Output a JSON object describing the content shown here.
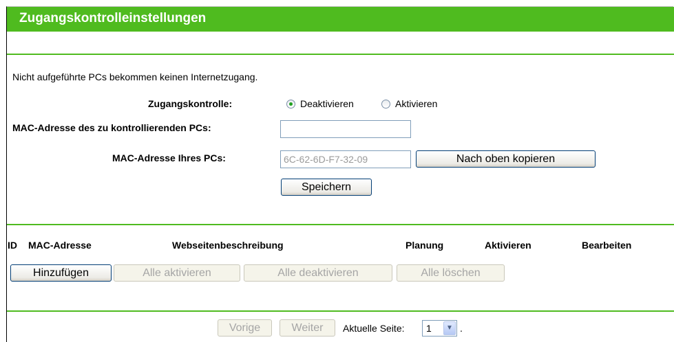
{
  "header": {
    "title": "Zugangskontrolleinstellungen"
  },
  "notice": "Nicht aufgeführte PCs bekommen keinen Internetzugang.",
  "access_control": {
    "label": "Zugangskontrolle:",
    "options": [
      {
        "label": "Deaktivieren",
        "selected": true
      },
      {
        "label": "Aktivieren",
        "selected": false
      }
    ]
  },
  "mac_control": {
    "label": "MAC-Adresse des zu kontrollierenden PCs:",
    "value": ""
  },
  "mac_own": {
    "label": "MAC-Adresse Ihres PCs:",
    "value": "6C-62-6D-F7-32-09",
    "copy_button": "Nach oben kopieren"
  },
  "save_button": "Speichern",
  "table": {
    "columns": [
      "ID",
      "MAC-Adresse",
      "Webseitenbeschreibung",
      "Planung",
      "Aktivieren",
      "Bearbeiten"
    ],
    "rows": []
  },
  "actions": {
    "add": "Hinzufügen",
    "enable_all": "Alle aktivieren",
    "disable_all": "Alle deaktivieren",
    "delete_all": "Alle löschen"
  },
  "pagination": {
    "prev": "Vorige",
    "next": "Weiter",
    "current_label": "Aktuelle Seite:",
    "current_page": "1",
    "trailing": "."
  },
  "colors": {
    "accent": "#4fbb1f",
    "input_border": "#7f9db9",
    "radio_dot": "#21a121"
  }
}
